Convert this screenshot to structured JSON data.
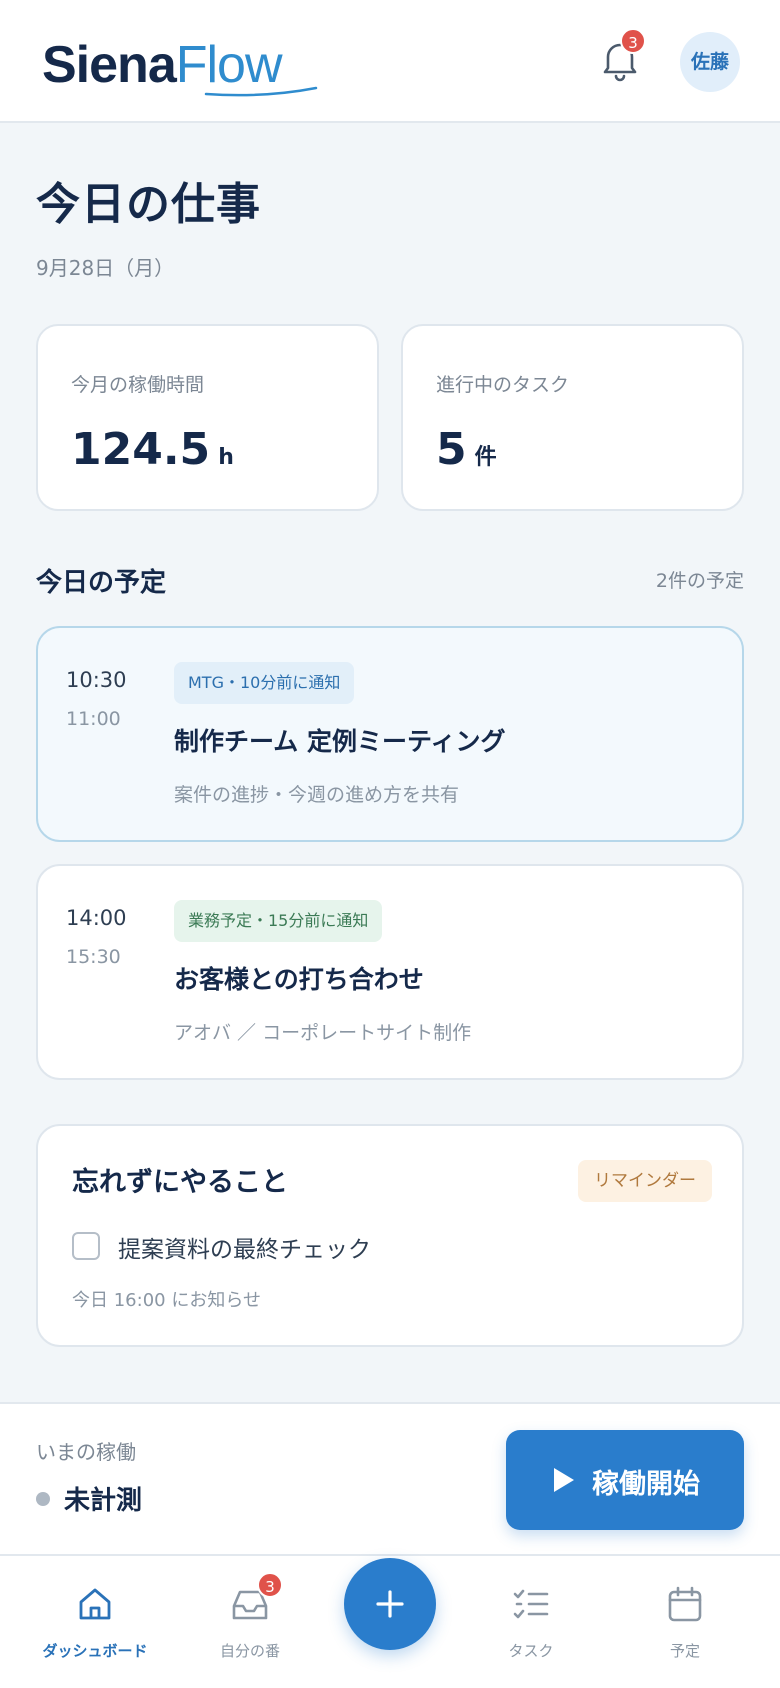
{
  "header": {
    "logo_part1": "Siena",
    "logo_part2": "Flow",
    "notification_count": "3",
    "avatar_label": "佐藤"
  },
  "main": {
    "title": "今日の仕事",
    "date": "9月28日（月）",
    "stats": [
      {
        "label": "今月の稼働時間",
        "value": "124.5",
        "unit": "h"
      },
      {
        "label": "進行中のタスク",
        "value": "5",
        "unit": "件"
      }
    ],
    "schedule": {
      "title": "今日の予定",
      "count": "2件の予定",
      "events": [
        {
          "start": "10:30",
          "end": "11:00",
          "tag": "MTG・10分前に通知",
          "title": "制作チーム 定例ミーティング",
          "subtitle": "案件の進捗・今週の進め方を共有"
        },
        {
          "start": "14:00",
          "end": "15:30",
          "tag": "業務予定・15分前に通知",
          "title": "お客様との打ち合わせ",
          "subtitle": "アオバ ／ コーポレートサイト制作"
        }
      ]
    },
    "reminder": {
      "title": "忘れずにやること",
      "badge": "リマインダー",
      "item": "提案資料の最終チェック",
      "checked": false,
      "time": "今日 16:00 にお知らせ"
    }
  },
  "tracking": {
    "label": "いまの稼働",
    "status": "未計測",
    "button": "稼働開始"
  },
  "nav": {
    "items": [
      {
        "label": "ダッシュボード",
        "icon": "home-icon",
        "active": true
      },
      {
        "label": "自分の番",
        "icon": "inbox-icon",
        "badge": "3"
      },
      {
        "label": "タスク",
        "icon": "checklist-icon"
      },
      {
        "label": "予定",
        "icon": "calendar-icon"
      }
    ],
    "fab_icon": "plus-icon"
  },
  "colors": {
    "accent": "#2a7dcc",
    "badge": "#e0524a",
    "text_dark": "#15294a",
    "background": "#f2f6f9"
  }
}
